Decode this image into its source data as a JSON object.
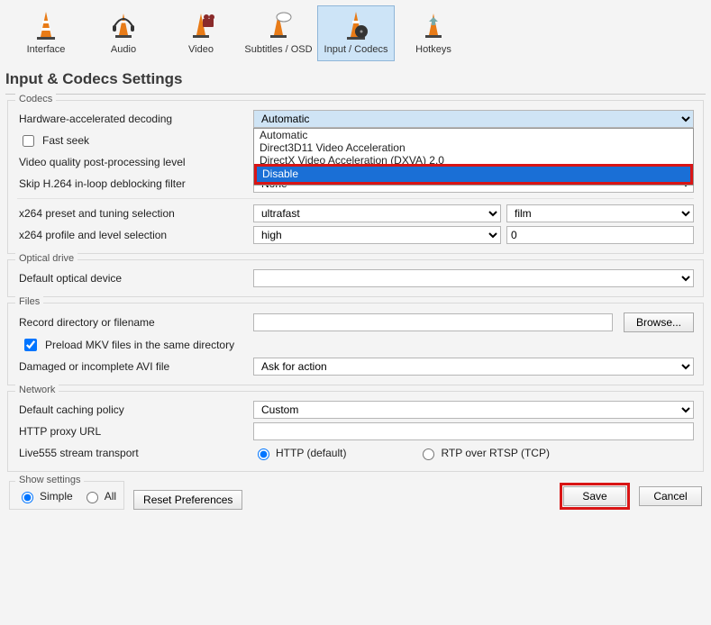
{
  "tabs": {
    "interface": "Interface",
    "audio": "Audio",
    "video": "Video",
    "subtitles": "Subtitles / OSD",
    "inputcodecs": "Input / Codecs",
    "hotkeys": "Hotkeys"
  },
  "page_title": "Input & Codecs Settings",
  "codecs": {
    "legend": "Codecs",
    "hw_decoding_label": "Hardware-accelerated decoding",
    "hw_decoding_value": "Automatic",
    "hw_decoding_options": {
      "o0": "Automatic",
      "o1": "Direct3D11 Video Acceleration",
      "o2": "DirectX Video Acceleration (DXVA) 2.0",
      "o3": "Disable"
    },
    "fast_seek_label": "Fast seek",
    "vq_label": "Video quality post-processing level",
    "skip_label": "Skip H.264 in-loop deblocking filter",
    "skip_value": "None",
    "x264_preset_label": "x264 preset and tuning selection",
    "x264_preset_value": "ultrafast",
    "x264_tune_value": "film",
    "x264_profile_label": "x264 profile and level selection",
    "x264_profile_value": "high",
    "x264_level_value": "0"
  },
  "optical": {
    "legend": "Optical drive",
    "default_device_label": "Default optical device",
    "default_device_value": ""
  },
  "files": {
    "legend": "Files",
    "record_label": "Record directory or filename",
    "record_value": "",
    "browse_label": "Browse...",
    "preload_label": "Preload MKV files in the same directory",
    "avi_label": "Damaged or incomplete AVI file",
    "avi_value": "Ask for action"
  },
  "network": {
    "legend": "Network",
    "caching_label": "Default caching policy",
    "caching_value": "Custom",
    "proxy_label": "HTTP proxy URL",
    "proxy_value": "",
    "live555_label": "Live555 stream transport",
    "live555_http": "HTTP (default)",
    "live555_rtp": "RTP over RTSP (TCP)"
  },
  "bottom": {
    "show_settings_legend": "Show settings",
    "simple": "Simple",
    "all": "All",
    "reset": "Reset Preferences",
    "save": "Save",
    "cancel": "Cancel"
  }
}
